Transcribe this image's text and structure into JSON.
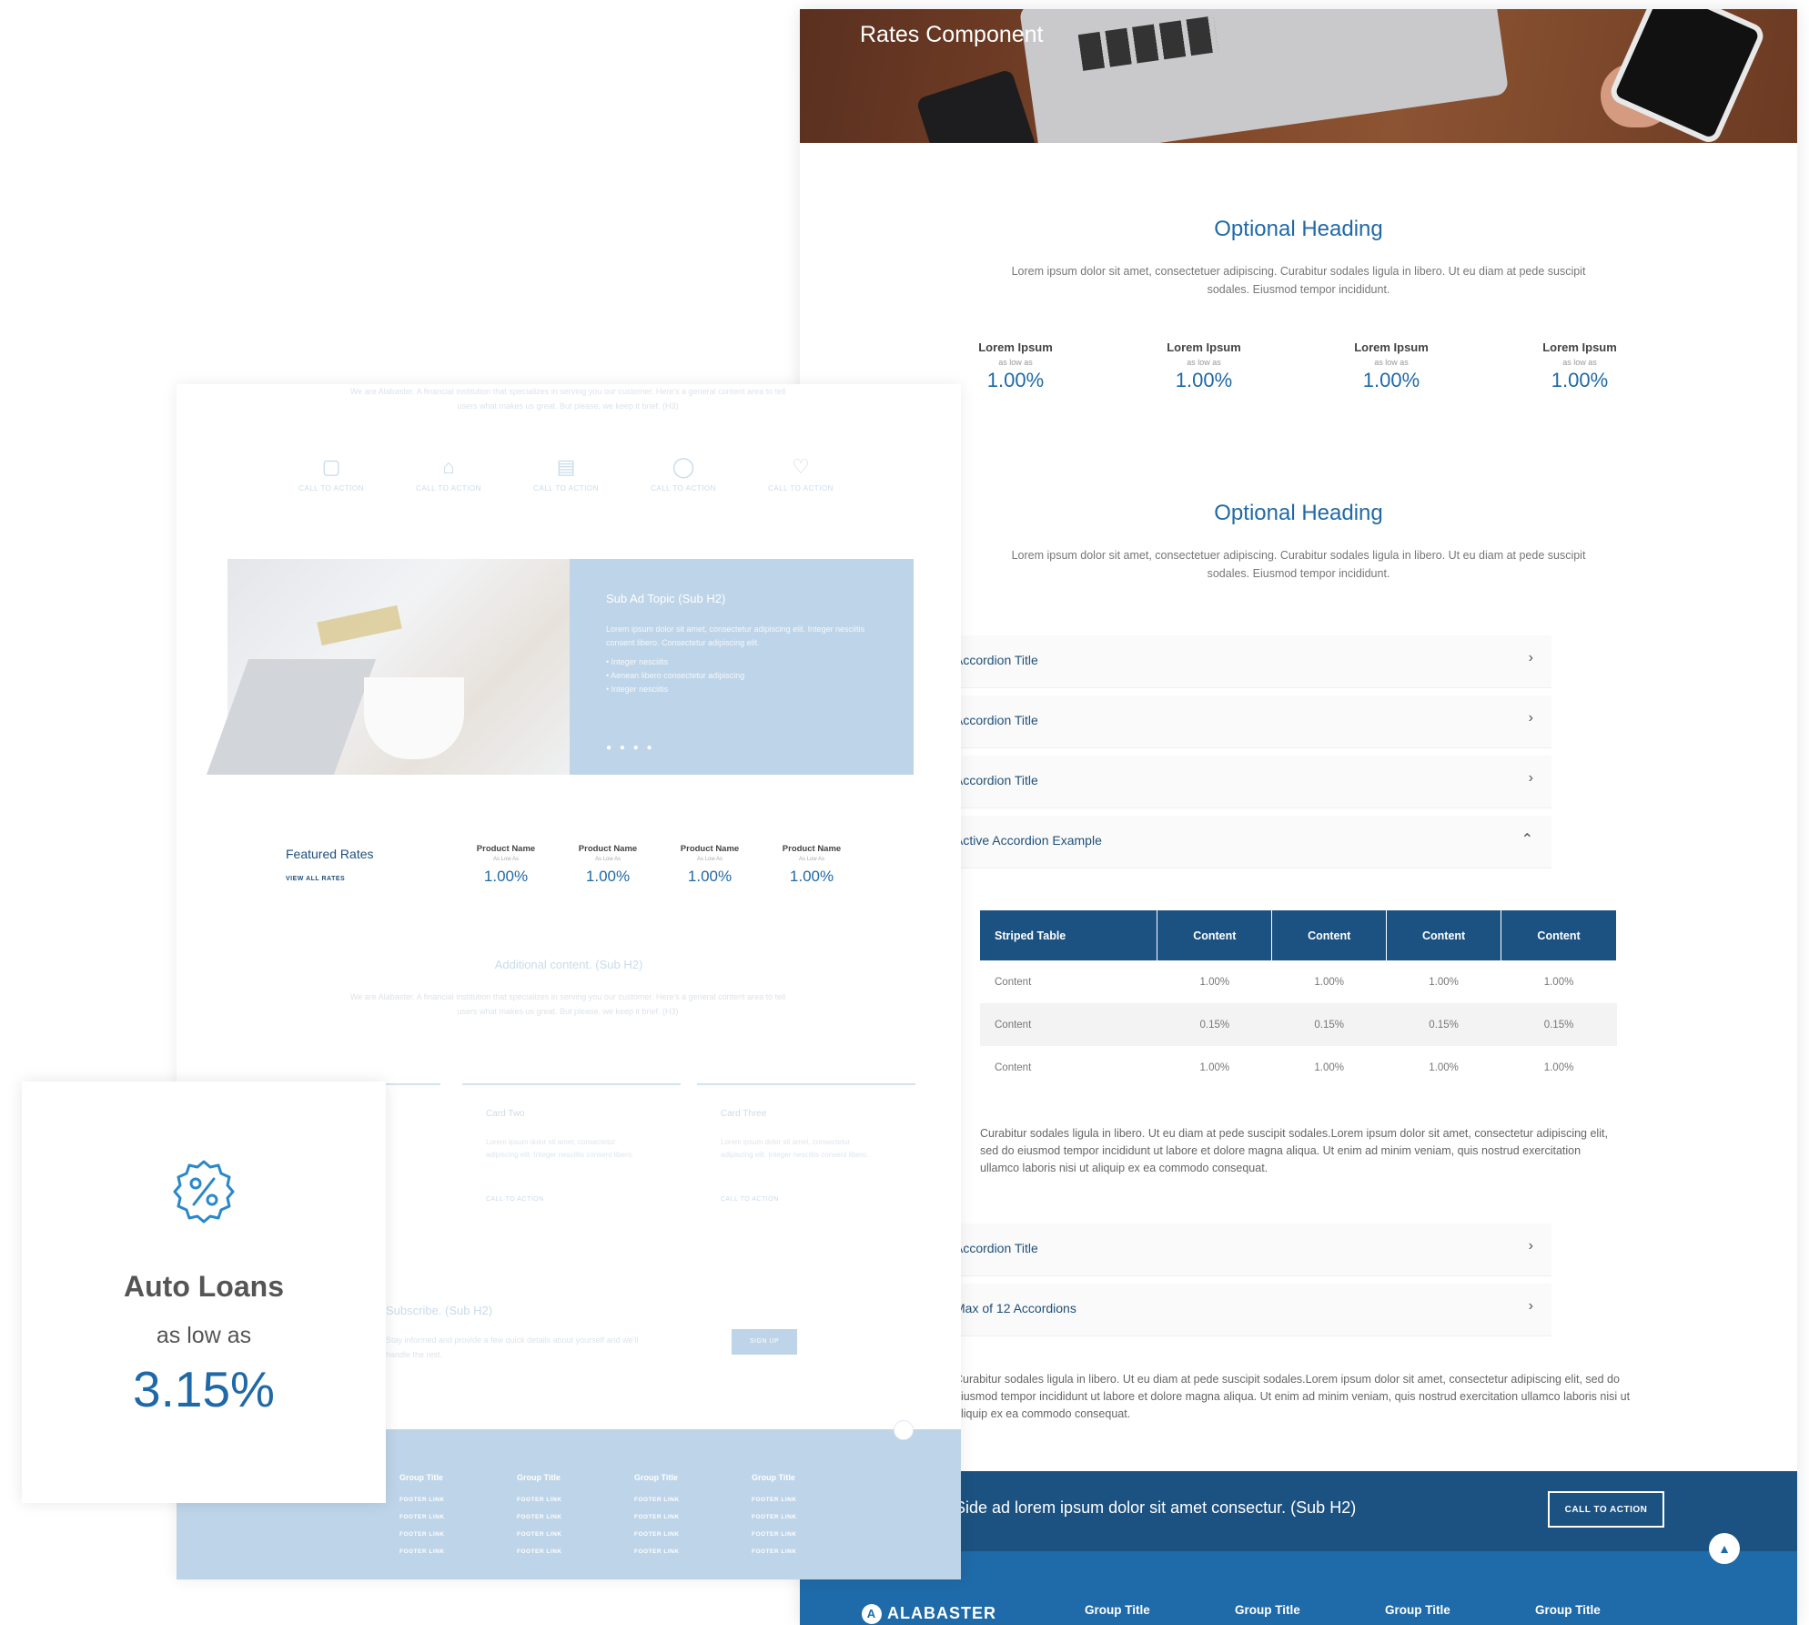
{
  "right_page": {
    "hero_title": "Rates Component",
    "sections": [
      {
        "heading": "Optional Heading",
        "text": "Lorem ipsum dolor sit amet, consectetuer adipiscing. Curabitur sodales ligula in libero. Ut eu diam at pede suscipit sodales. Eiusmod tempor incididunt."
      },
      {
        "heading": "Optional Heading",
        "text": "Lorem ipsum dolor sit amet, consectetuer adipiscing. Curabitur sodales ligula in libero. Ut eu diam at pede suscipit sodales. Eiusmod tempor incididunt."
      }
    ],
    "rates": [
      {
        "name": "Lorem Ipsum",
        "as_low_as": "as low as",
        "value": "1.00%"
      },
      {
        "name": "Lorem Ipsum",
        "as_low_as": "as low as",
        "value": "1.00%"
      },
      {
        "name": "Lorem Ipsum",
        "as_low_as": "as low as",
        "value": "1.00%"
      },
      {
        "name": "Lorem Ipsum",
        "as_low_as": "as low as",
        "value": "1.00%"
      }
    ],
    "accordions": [
      {
        "title": "Accordion Title",
        "icon": "›"
      },
      {
        "title": "Accordion Title",
        "icon": "›"
      },
      {
        "title": "Accordion Title",
        "icon": "›"
      },
      {
        "title": "Active Accordion Example",
        "icon": "⌃"
      },
      {
        "title": "Accordion Title",
        "icon": "›"
      },
      {
        "title": "Max of 12 Accordions",
        "icon": "›"
      }
    ],
    "table": {
      "headers": [
        "Striped Table",
        "Content",
        "Content",
        "Content",
        "Content"
      ],
      "rows": [
        [
          "Content",
          "1.00%",
          "1.00%",
          "1.00%",
          "1.00%"
        ],
        [
          "Content",
          "0.15%",
          "0.15%",
          "0.15%",
          "0.15%"
        ],
        [
          "Content",
          "1.00%",
          "1.00%",
          "1.00%",
          "1.00%"
        ]
      ]
    },
    "paragraph_1": "Curabitur sodales ligula in libero. Ut eu diam at pede suscipit sodales.Lorem ipsum dolor sit amet, consectetur adipiscing elit, sed do eiusmod tempor incididunt ut labore et dolore magna aliqua. Ut enim ad minim veniam, quis nostrud exercitation ullamco laboris nisi ut aliquip ex ea commodo consequat.",
    "paragraph_2": "Curabitur sodales ligula in libero. Ut eu diam at pede suscipit sodales.Lorem ipsum dolor sit amet, consectetur adipiscing elit, sed do eiusmod tempor incididunt ut labore et dolore magna aliqua. Ut enim ad minim veniam, quis nostrud exercitation ullamco laboris nisi ut aliquip ex ea commodo consequat.",
    "cta_text": "Side ad lorem ipsum dolor sit amet consectur. (Sub H2)",
    "cta_button": "CALL TO ACTION",
    "scroll_top": "▲",
    "footer": {
      "logo_mark": "A",
      "logo": "ALABASTER",
      "groups": [
        "Group Title",
        "Group Title",
        "Group Title",
        "Group Title"
      ]
    }
  },
  "left_page": {
    "intro": "We are Alabaster. A financial institution that specializes in serving you our customer. Here's a general content area to tell users what makes us great. But please, we keep it brief. (H3)",
    "icons": [
      {
        "glyph": "▢",
        "label": "CALL TO ACTION"
      },
      {
        "glyph": "⌂",
        "label": "CALL TO ACTION"
      },
      {
        "glyph": "▤",
        "label": "CALL TO ACTION"
      },
      {
        "glyph": "◯",
        "label": "CALL TO ACTION"
      },
      {
        "glyph": "♡",
        "label": "CALL TO ACTION"
      }
    ],
    "slide": {
      "heading": "Sub Ad Topic (Sub H2)",
      "body": "Lorem ipsum dolor sit amet, consectetur adipiscing elit. Integer nesciitis consent libero. Consectetur adipiscing elit.",
      "bullets": "• Integer nesciitis\n• Aenean libero consectetur adipiscing\n• Integer nesciitis",
      "dots": "● ● ● ●"
    },
    "featured": {
      "title": "Featured Rates",
      "view_all": "VIEW ALL RATES",
      "products": [
        {
          "name": "Product Name",
          "as_low_as": "As Low As",
          "value": "1.00%"
        },
        {
          "name": "Product Name",
          "as_low_as": "As Low As",
          "value": "1.00%"
        },
        {
          "name": "Product Name",
          "as_low_as": "As Low As",
          "value": "1.00%"
        },
        {
          "name": "Product Name",
          "as_low_as": "As Low As",
          "value": "1.00%"
        }
      ]
    },
    "additional": {
      "heading": "Additional content. (Sub H2)",
      "text": "We are Alabaster. A financial institution that specializes in serving you our customer. Here's a general content area to tell users what makes us great. But please, we keep it brief. (H3)"
    },
    "cards": [
      {
        "title": "Card Two",
        "body": "Lorem ipsum dolor sit amet, consectetur adipiscing elit. Integer nesciitis consent libero.",
        "cta": "CALL TO ACTION"
      },
      {
        "title": "Card Three",
        "body": "Lorem ipsum dolor sit amet, consectetur adipiscing elit. Integer nesciitis consent libero.",
        "cta": "CALL TO ACTION"
      }
    ],
    "subscribe": {
      "heading": "Subscribe. (Sub H2)",
      "text": "Stay informed and provide a few quick details about yourself and we'll handle the rest.",
      "button": "SIGN UP"
    },
    "footer_groups": [
      {
        "title": "Group Title",
        "links": [
          "FOOTER LINK",
          "FOOTER LINK",
          "FOOTER LINK",
          "FOOTER LINK"
        ]
      },
      {
        "title": "Group Title",
        "links": [
          "FOOTER LINK",
          "FOOTER LINK",
          "FOOTER LINK",
          "FOOTER LINK"
        ]
      },
      {
        "title": "Group Title",
        "links": [
          "FOOTER LINK",
          "FOOTER LINK",
          "FOOTER LINK",
          "FOOTER LINK"
        ]
      },
      {
        "title": "Group Title",
        "links": [
          "FOOTER LINK",
          "FOOTER LINK",
          "FOOTER LINK",
          "FOOTER LINK"
        ]
      }
    ]
  },
  "auto_card": {
    "icon": "percent-badge-icon",
    "title": "Auto Loans",
    "subtitle": "as low as",
    "value": "3.15%"
  },
  "colors": {
    "brand_blue": "#1f69a7",
    "dark_blue": "#1c5281",
    "faded_blue": "#bed4e8"
  }
}
